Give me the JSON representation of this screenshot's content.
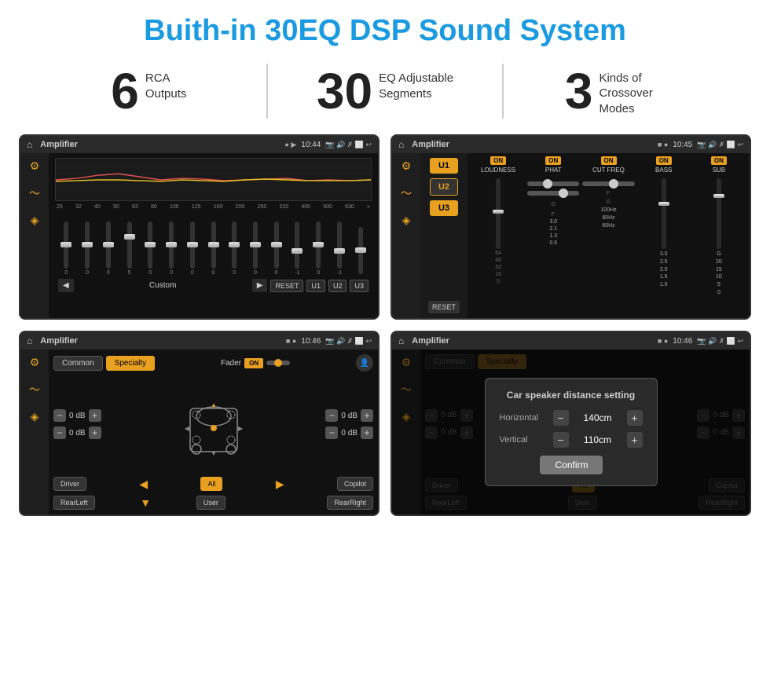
{
  "header": {
    "title": "Buith-in 30EQ DSP Sound System"
  },
  "stats": [
    {
      "number": "6",
      "label": "RCA\nOutputs"
    },
    {
      "number": "30",
      "label": "EQ Adjustable\nSegments"
    },
    {
      "number": "3",
      "label": "Kinds of\nCrossover Modes"
    }
  ],
  "screens": [
    {
      "id": "eq-screen",
      "title": "Amplifier",
      "time": "10:44",
      "type": "eq"
    },
    {
      "id": "amp-screen",
      "title": "Amplifier",
      "time": "10:45",
      "type": "amp2"
    },
    {
      "id": "fader-screen",
      "title": "Amplifier",
      "time": "10:46",
      "type": "fader"
    },
    {
      "id": "dialog-screen",
      "title": "Amplifier",
      "time": "10:46",
      "type": "dialog",
      "dialog": {
        "title": "Car speaker distance setting",
        "horizontal_label": "Horizontal",
        "horizontal_value": "140cm",
        "vertical_label": "Vertical",
        "vertical_value": "110cm",
        "confirm_label": "Confirm"
      }
    }
  ],
  "eq": {
    "freqs": [
      "25",
      "32",
      "40",
      "50",
      "63",
      "80",
      "100",
      "125",
      "160",
      "200",
      "250",
      "320",
      "400",
      "500",
      "630"
    ],
    "values": [
      "0",
      "0",
      "0",
      "5",
      "0",
      "0",
      "0",
      "0",
      "0",
      "0",
      "0",
      "-1",
      "0",
      "-1",
      ""
    ],
    "preset": "Custom",
    "buttons": [
      "RESET",
      "U1",
      "U2",
      "U3"
    ]
  },
  "fader": {
    "tabs": [
      "Common",
      "Specialty"
    ],
    "active_tab": "Specialty",
    "fader_label": "Fader",
    "db_values": [
      "0 dB",
      "0 dB",
      "0 dB",
      "0 dB"
    ],
    "buttons": [
      "Driver",
      "All",
      "Copilot",
      "RearLeft",
      "User",
      "RearRight"
    ]
  },
  "dialog": {
    "title": "Car speaker distance setting",
    "horizontal": "140cm",
    "vertical": "110cm",
    "confirm": "Confirm",
    "db_right_top": "0 dB",
    "db_right_bottom": "0 dB"
  },
  "amp2": {
    "channels": [
      "LOUDNESS",
      "PHAT",
      "CUT FREQ",
      "BASS",
      "SUB"
    ],
    "u_buttons": [
      "U1",
      "U2",
      "U3"
    ],
    "reset": "RESET"
  }
}
